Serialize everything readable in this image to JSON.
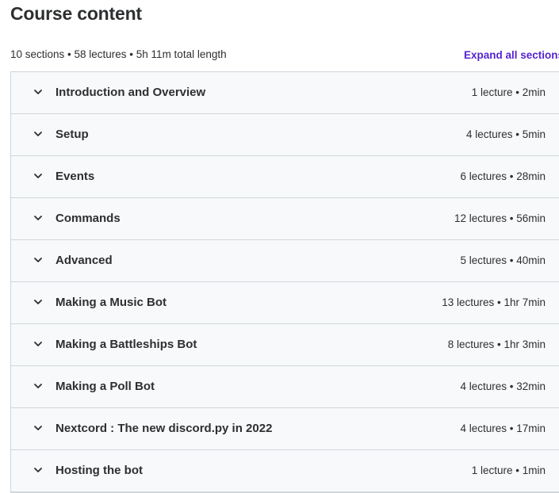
{
  "header": {
    "title": "Course content",
    "summary": "10 sections • 58 lectures • 5h 11m total length",
    "expand_all_label": "Expand all sections"
  },
  "sections": [
    {
      "title": "Introduction and Overview",
      "meta": "1 lecture • 2min",
      "icon": "chevron-down-icon"
    },
    {
      "title": "Setup",
      "meta": "4 lectures • 5min",
      "icon": "chevron-down-icon"
    },
    {
      "title": "Events",
      "meta": "6 lectures • 28min",
      "icon": "chevron-down-icon"
    },
    {
      "title": "Commands",
      "meta": "12 lectures • 56min",
      "icon": "chevron-down-icon"
    },
    {
      "title": "Advanced",
      "meta": "5 lectures • 40min",
      "icon": "chevron-down-icon"
    },
    {
      "title": "Making a Music Bot",
      "meta": "13 lectures • 1hr 7min",
      "icon": "chevron-down-icon"
    },
    {
      "title": "Making a Battleships Bot",
      "meta": "8 lectures • 1hr 3min",
      "icon": "chevron-down-icon"
    },
    {
      "title": "Making a Poll Bot",
      "meta": "4 lectures • 32min",
      "icon": "chevron-down-icon"
    },
    {
      "title": "Nextcord : The new discord.py in 2022",
      "meta": "4 lectures • 17min",
      "icon": "chevron-down-icon"
    },
    {
      "title": "Hosting the bot",
      "meta": "1 lecture • 1min",
      "icon": "chevron-down-icon"
    }
  ],
  "colors": {
    "text": "#2d2f31",
    "accent": "#5624d0",
    "section_bg": "#f7f9fa",
    "border": "#d1d7dc"
  }
}
